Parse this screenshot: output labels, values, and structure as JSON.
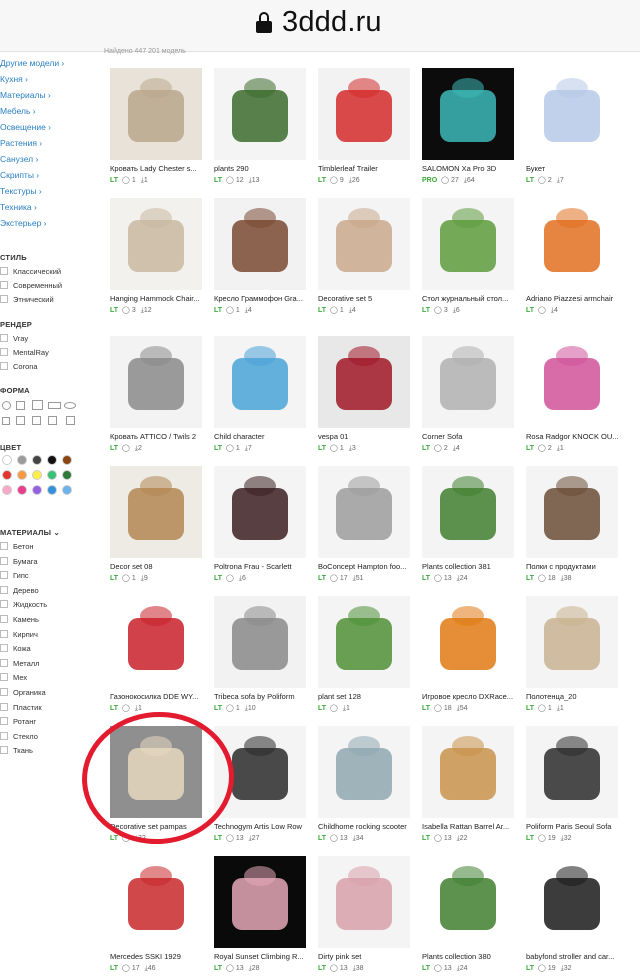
{
  "browser": {
    "domain": "3ddd.ru"
  },
  "results_note": "Найдено 447 201 модель",
  "sidebar": {
    "categories": [
      "Другие модели",
      "Кухня",
      "Материалы",
      "Мебель",
      "Освещение",
      "Растения",
      "Санузел",
      "Скрипты",
      "Текстуры",
      "Техника",
      "Экстерьер"
    ],
    "style_title": "СТИЛЬ",
    "styles": [
      "Классический",
      "Современный",
      "Этнический"
    ],
    "render_title": "РЕНДЕР",
    "renders": [
      "Vray",
      "MentalRay",
      "Corona"
    ],
    "form_title": "ФОРМА",
    "color_title": "ЦВЕТ",
    "colors": [
      "#ffffff",
      "#9a9a9a",
      "#444444",
      "#111111",
      "#8b4513",
      "#e3342f",
      "#f6993f",
      "#ffed4a",
      "#38c172",
      "#2d7a3a",
      "#f9a8c9",
      "#e83e8c",
      "#9561e2",
      "#3490dc",
      "#6cb2eb"
    ],
    "materials_title": "МАТЕРИАЛЫ",
    "materials": [
      "Бетон",
      "Бумага",
      "Гипс",
      "Дерево",
      "Жидкость",
      "Камень",
      "Кирпич",
      "Кожа",
      "Металл",
      "Мех",
      "Органика",
      "Пластик",
      "Ротанг",
      "Стекло",
      "Ткань"
    ]
  },
  "cards": [
    {
      "title": "Кровать Lady Chester s...",
      "tier": "LT",
      "c": "1",
      "d": "1"
    },
    {
      "title": "plants 290",
      "tier": "LT",
      "c": "12",
      "d": "13"
    },
    {
      "title": "Timblerleaf Trailer",
      "tier": "LT",
      "c": "9",
      "d": "26"
    },
    {
      "title": "SALOMON Xa Pro 3D",
      "tier": "PRO",
      "c": "27",
      "d": "64"
    },
    {
      "title": "Букет",
      "tier": "LT",
      "c": "2",
      "d": "7"
    },
    {
      "title": "Hanging Hammock Chair...",
      "tier": "LT",
      "c": "3",
      "d": "12"
    },
    {
      "title": "Кресло Граммофон Gra...",
      "tier": "LT",
      "c": "1",
      "d": "4"
    },
    {
      "title": "Decorative set 5",
      "tier": "LT",
      "c": "1",
      "d": "4"
    },
    {
      "title": "Стол журнальный стол...",
      "tier": "LT",
      "c": "3",
      "d": "6"
    },
    {
      "title": "Adriano Piazzesi armchair",
      "tier": "LT",
      "c": "",
      "d": "4"
    },
    {
      "title": "Кровать ATTICO / Twils 2",
      "tier": "LT",
      "c": "",
      "d": "2"
    },
    {
      "title": "Child character",
      "tier": "LT",
      "c": "1",
      "d": "7"
    },
    {
      "title": "vespa 01",
      "tier": "LT",
      "c": "1",
      "d": "3"
    },
    {
      "title": "Corner Sofa",
      "tier": "LT",
      "c": "2",
      "d": "4"
    },
    {
      "title": "Rosa Radgor KNOCK OU...",
      "tier": "LT",
      "c": "2",
      "d": "1"
    },
    {
      "title": "Decor set 08",
      "tier": "LT",
      "c": "1",
      "d": "9"
    },
    {
      "title": "Poltrona Frau - Scarlett",
      "tier": "LT",
      "c": "",
      "d": "6"
    },
    {
      "title": "BoConcept Hampton foo...",
      "tier": "LT",
      "c": "17",
      "d": "51"
    },
    {
      "title": "Plants collection 381",
      "tier": "LT",
      "c": "13",
      "d": "24"
    },
    {
      "title": "Полки с продуктами",
      "tier": "LT",
      "c": "18",
      "d": "38"
    },
    {
      "title": "Газонокосилка DDE WY...",
      "tier": "LT",
      "c": "",
      "d": "1"
    },
    {
      "title": "Tribeca sofa by Poliform",
      "tier": "LT",
      "c": "1",
      "d": "10"
    },
    {
      "title": "plant set 128",
      "tier": "LT",
      "c": "",
      "d": "1"
    },
    {
      "title": "Игровое кресло DXRace...",
      "tier": "LT",
      "c": "18",
      "d": "54"
    },
    {
      "title": "Полотенца_20",
      "tier": "LT",
      "c": "1",
      "d": "1"
    },
    {
      "title": "Decorative set pampas",
      "tier": "LT",
      "c": "",
      "d": "32"
    },
    {
      "title": "Technogym Artis Low Row",
      "tier": "LT",
      "c": "13",
      "d": "27"
    },
    {
      "title": "Childhome rocking scooter",
      "tier": "LT",
      "c": "13",
      "d": "34"
    },
    {
      "title": "Isabella Rattan Barrel Ar...",
      "tier": "LT",
      "c": "13",
      "d": "22"
    },
    {
      "title": "Poliform Paris Seoul Sofa",
      "tier": "LT",
      "c": "19",
      "d": "32"
    },
    {
      "title": "Mercedes SSKI 1929",
      "tier": "LT",
      "c": "17",
      "d": "46"
    },
    {
      "title": "Royal Sunset Climbing R...",
      "tier": "LT",
      "c": "13",
      "d": "28"
    },
    {
      "title": "Dirty pink set",
      "tier": "LT",
      "c": "13",
      "d": "38"
    },
    {
      "title": "Plants collection 380",
      "tier": "LT",
      "c": "13",
      "d": "24"
    },
    {
      "title": "babyfond stroller and car...",
      "tier": "LT",
      "c": "19",
      "d": "32"
    }
  ]
}
